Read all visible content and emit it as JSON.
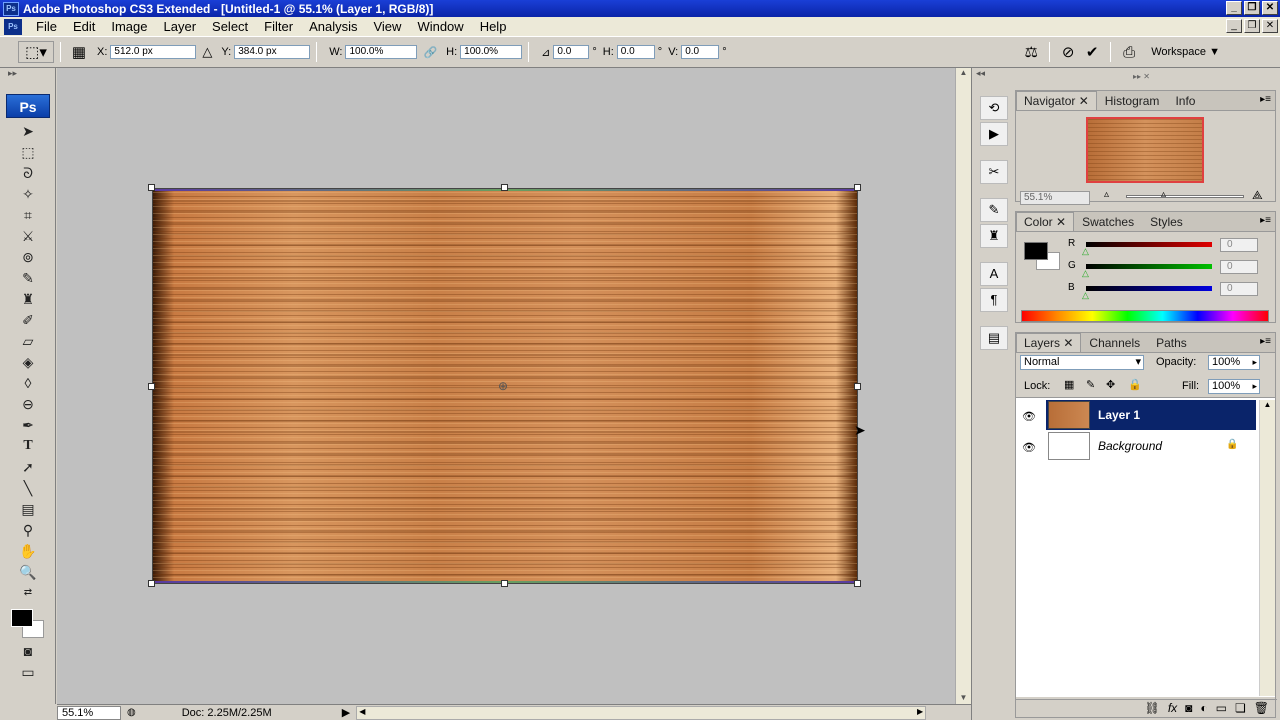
{
  "window": {
    "title": "Adobe Photoshop CS3 Extended - [Untitled-1 @ 55.1% (Layer 1, RGB/8)]",
    "app_icon": "Ps"
  },
  "menu": [
    "File",
    "Edit",
    "Image",
    "Layer",
    "Select",
    "Filter",
    "Analysis",
    "View",
    "Window",
    "Help"
  ],
  "options": {
    "x_label": "X:",
    "x_value": "512.0 px",
    "y_label": "Y:",
    "y_value": "384.0 px",
    "w_label": "W:",
    "w_value": "100.0%",
    "h_label": "H:",
    "h_value": "100.0%",
    "angle_value": "0.0",
    "angle_unit": "°",
    "hskew_label": "H:",
    "hskew_value": "0.0",
    "hskew_unit": "°",
    "vskew_label": "V:",
    "vskew_value": "0.0",
    "vskew_unit": "°",
    "workspace": "Workspace"
  },
  "toolbox": {
    "logo": "Ps"
  },
  "status": {
    "zoom": "55.1%",
    "doc": "Doc: 2.25M/2.25M"
  },
  "navigator": {
    "tabs": [
      "Navigator",
      "Histogram",
      "Info"
    ],
    "zoom": "55.1%"
  },
  "color": {
    "tabs": [
      "Color",
      "Swatches",
      "Styles"
    ],
    "channels": [
      {
        "label": "R",
        "value": "0",
        "color": "#e00000"
      },
      {
        "label": "G",
        "value": "0",
        "color": "#00c000"
      },
      {
        "label": "B",
        "value": "0",
        "color": "#0000e0"
      }
    ]
  },
  "layers": {
    "tabs": [
      "Layers",
      "Channels",
      "Paths"
    ],
    "blend_mode": "Normal",
    "opacity_label": "Opacity:",
    "opacity_value": "100%",
    "lock_label": "Lock:",
    "fill_label": "Fill:",
    "fill_value": "100%",
    "items": [
      {
        "name": "Layer 1",
        "selected": true
      },
      {
        "name": "Background",
        "selected": false
      }
    ]
  },
  "colors": {
    "title_bar": "#0a24a8",
    "selected_layer": "#0a246a",
    "wood": "#c87a42"
  }
}
